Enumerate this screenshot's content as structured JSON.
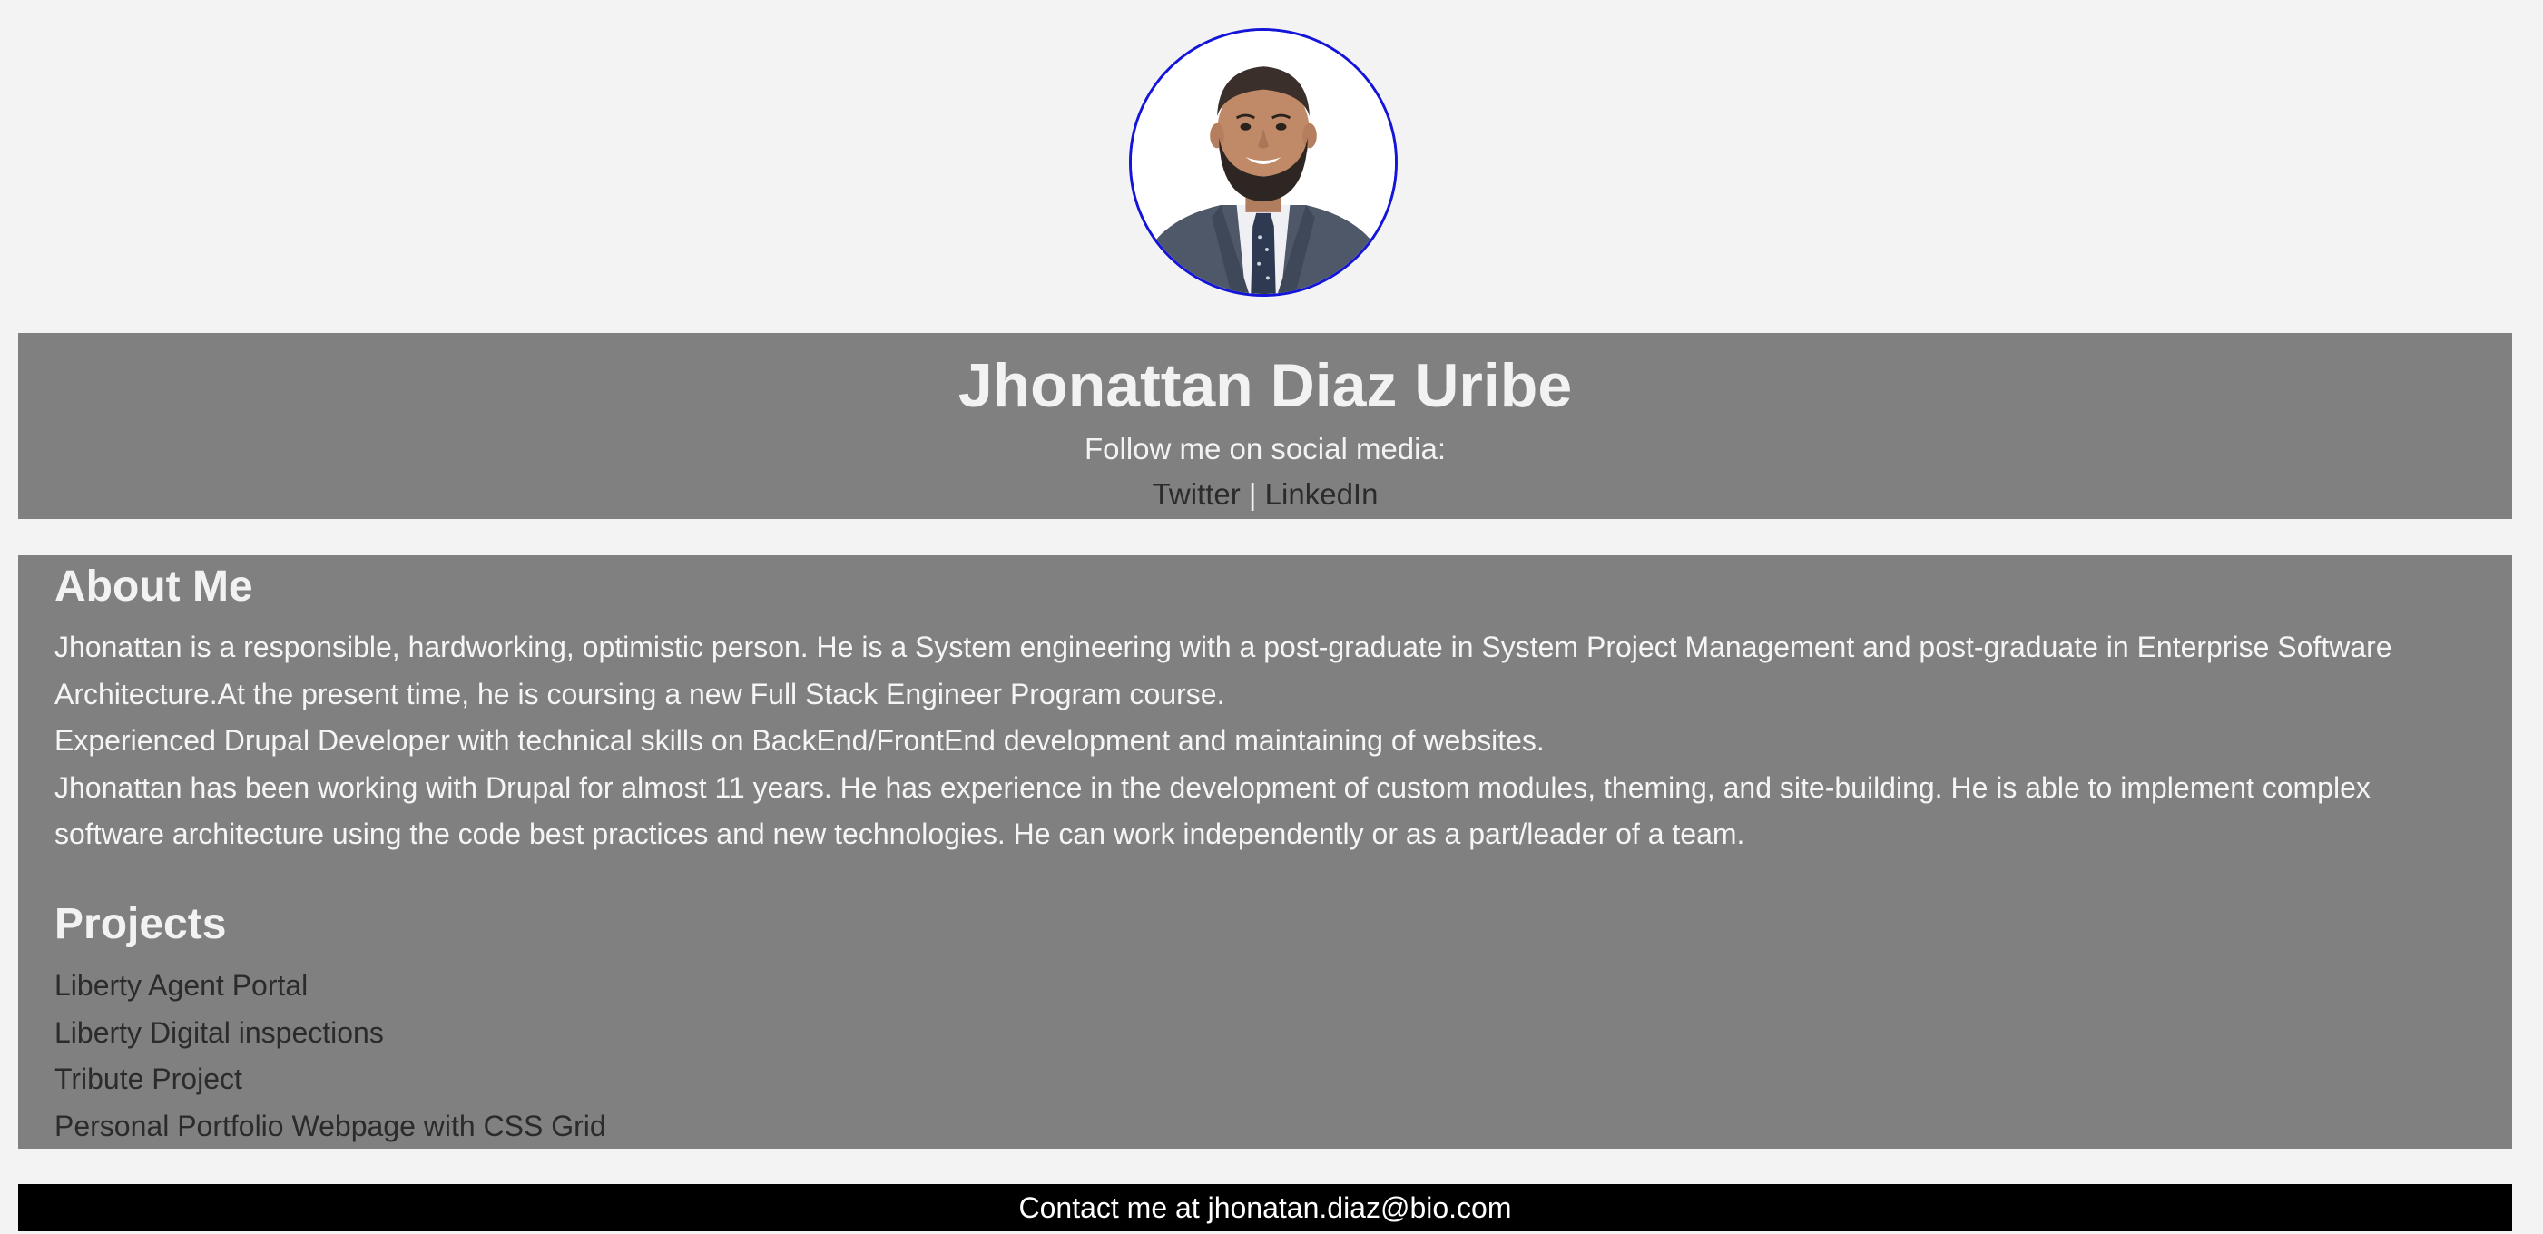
{
  "profile": {
    "name": "Jhonattan Diaz Uribe",
    "follow_text": "Follow me on social media:",
    "social_links": [
      {
        "label": "Twitter"
      },
      {
        "label": "LinkedIn"
      }
    ],
    "separator": "|",
    "avatar_border_color": "#1515d8"
  },
  "about": {
    "title": "About Me",
    "paragraphs": [
      "Jhonattan is a responsible, hardworking, optimistic person. He is a System engineering with a post-graduate in System Project Management and post-graduate in Enterprise Software Architecture.At the present time, he is coursing a new Full Stack Engineer Program course.",
      "Experienced Drupal Developer with technical skills on BackEnd/FrontEnd development and maintaining of websites.",
      "Jhonattan has been working with Drupal for almost 11 years. He has experience in the development of custom modules, theming, and site-building. He is able to implement complex software architecture using the code best practices and new technologies. He can work independently or as a part/leader of a team."
    ]
  },
  "projects": {
    "title": "Projects",
    "items": [
      {
        "label": "Liberty Agent Portal"
      },
      {
        "label": "Liberty Digital inspections"
      },
      {
        "label": "Tribute Project"
      },
      {
        "label": "Personal Portfolio Webpage with CSS Grid"
      }
    ]
  },
  "footer": {
    "contact_text": "Contact me at jhonatan.diaz@bio.com"
  },
  "colors": {
    "page_background": "#f3f3f3",
    "band_background": "#808080",
    "footer_background": "#000000",
    "link_color": "#2b2b2b"
  }
}
